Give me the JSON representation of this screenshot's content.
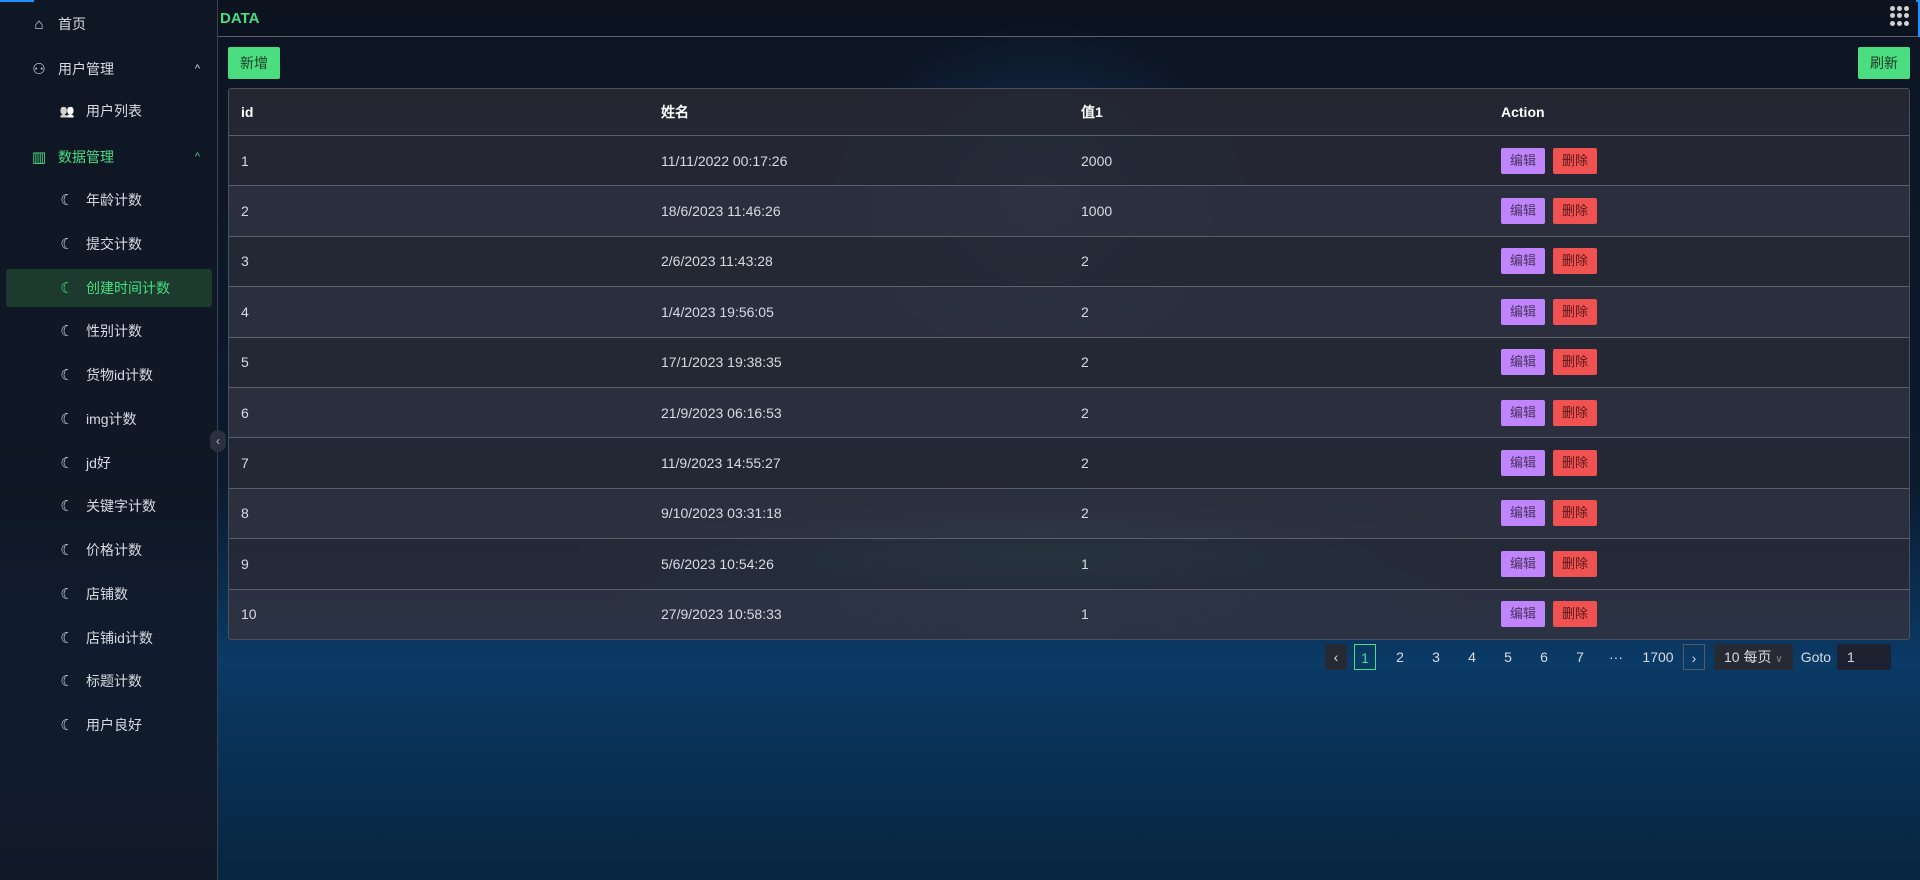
{
  "topbar": {
    "title": "DATA"
  },
  "sidebar": {
    "items": [
      {
        "label": "首页",
        "icon": "home-icon"
      },
      {
        "label": "用户管理",
        "icon": "users-outline-icon"
      },
      {
        "label": "用户列表",
        "icon": "users-filled-icon"
      },
      {
        "label": "数据管理",
        "icon": "bar-chart-icon"
      },
      {
        "label": "年龄计数",
        "icon": "moon-icon"
      },
      {
        "label": "提交计数",
        "icon": "moon-icon"
      },
      {
        "label": "创建时间计数",
        "icon": "moon-icon"
      },
      {
        "label": "性别计数",
        "icon": "moon-icon"
      },
      {
        "label": "货物id计数",
        "icon": "moon-icon"
      },
      {
        "label": "img计数",
        "icon": "moon-icon"
      },
      {
        "label": "jd好",
        "icon": "moon-icon"
      },
      {
        "label": "关键字计数",
        "icon": "moon-icon"
      },
      {
        "label": "价格计数",
        "icon": "moon-icon"
      },
      {
        "label": "店铺数",
        "icon": "moon-icon"
      },
      {
        "label": "店铺id计数",
        "icon": "moon-icon"
      },
      {
        "label": "标题计数",
        "icon": "moon-icon"
      },
      {
        "label": "用户良好",
        "icon": "moon-icon"
      }
    ]
  },
  "toolbar": {
    "add": "新增",
    "refresh": "刷新"
  },
  "table": {
    "headers": [
      "id",
      "姓名",
      "值1",
      "Action"
    ],
    "rows": [
      [
        "1",
        "11/11/2022 00:17:26",
        "2000"
      ],
      [
        "2",
        "18/6/2023 11:46:26",
        "1000"
      ],
      [
        "3",
        "2/6/2023 11:43:28",
        "2"
      ],
      [
        "4",
        "1/4/2023 19:56:05",
        "2"
      ],
      [
        "5",
        "17/1/2023 19:38:35",
        "2"
      ],
      [
        "6",
        "21/9/2023 06:16:53",
        "2"
      ],
      [
        "7",
        "11/9/2023 14:55:27",
        "2"
      ],
      [
        "8",
        "9/10/2023 03:31:18",
        "2"
      ],
      [
        "9",
        "5/6/2023 10:54:26",
        "1"
      ],
      [
        "10",
        "27/9/2023 10:58:33",
        "1"
      ]
    ],
    "edit": "编辑",
    "delete": "删除"
  },
  "pagination": {
    "pages": [
      "1",
      "2",
      "3",
      "4",
      "5",
      "6",
      "7"
    ],
    "ellipsis": "···",
    "last": "1700",
    "current": "1",
    "page_size": "10 每页",
    "goto_label": "Goto",
    "goto_value": "1"
  },
  "colors": {
    "accent": "#4ade80",
    "edit": "#c084fc",
    "delete": "#f05252"
  }
}
